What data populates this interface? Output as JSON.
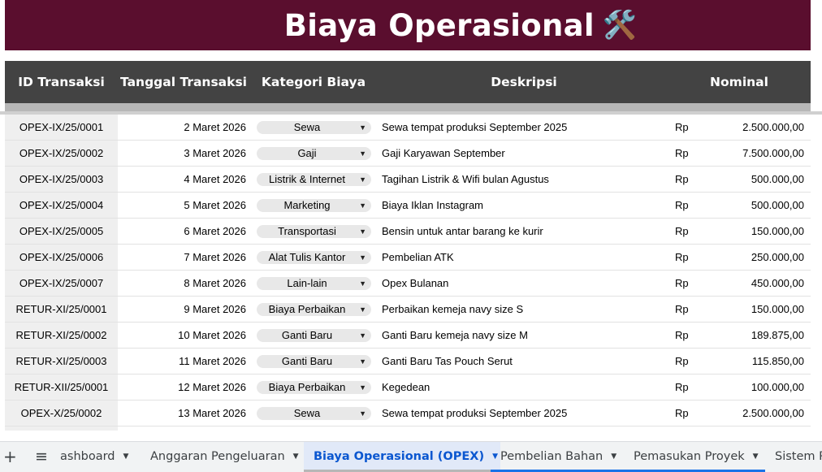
{
  "sheet": {
    "title": "Biaya Operasional",
    "title_icon": "🛠️",
    "headers": {
      "id": "ID Transaksi",
      "date": "Tanggal Transaksi",
      "category": "Kategori Biaya",
      "description": "Deskripsi",
      "amount": "Nominal"
    },
    "rows": [
      {
        "id": "OPEX-IX/25/0001",
        "date": "2 Maret 2026",
        "category": "Sewa",
        "description": "Sewa tempat produksi September 2025",
        "currency": "Rp",
        "amount": "2.500.000,00"
      },
      {
        "id": "OPEX-IX/25/0002",
        "date": "3 Maret 2026",
        "category": "Gaji",
        "description": "Gaji Karyawan September",
        "currency": "Rp",
        "amount": "7.500.000,00"
      },
      {
        "id": "OPEX-IX/25/0003",
        "date": "4 Maret 2026",
        "category": "Listrik & Internet",
        "description": "Tagihan Listrik & Wifi bulan Agustus",
        "currency": "Rp",
        "amount": "500.000,00"
      },
      {
        "id": "OPEX-IX/25/0004",
        "date": "5 Maret 2026",
        "category": "Marketing",
        "description": "Biaya Iklan Instagram",
        "currency": "Rp",
        "amount": "500.000,00"
      },
      {
        "id": "OPEX-IX/25/0005",
        "date": "6 Maret 2026",
        "category": "Transportasi",
        "description": "Bensin untuk antar barang ke kurir",
        "currency": "Rp",
        "amount": "150.000,00"
      },
      {
        "id": "OPEX-IX/25/0006",
        "date": "7 Maret 2026",
        "category": "Alat Tulis Kantor",
        "description": "Pembelian ATK",
        "currency": "Rp",
        "amount": "250.000,00"
      },
      {
        "id": "OPEX-IX/25/0007",
        "date": "8 Maret 2026",
        "category": "Lain-lain",
        "description": "Opex Bulanan",
        "currency": "Rp",
        "amount": "450.000,00"
      },
      {
        "id": "RETUR-XI/25/0001",
        "date": "9 Maret 2026",
        "category": "Biaya Perbaikan",
        "description": "Perbaikan kemeja navy size S",
        "currency": "Rp",
        "amount": "150.000,00"
      },
      {
        "id": "RETUR-XI/25/0002",
        "date": "10 Maret 2026",
        "category": "Ganti Baru",
        "description": "Ganti Baru kemeja navy size M",
        "currency": "Rp",
        "amount": "189.875,00"
      },
      {
        "id": "RETUR-XI/25/0003",
        "date": "11 Maret 2026",
        "category": "Ganti Baru",
        "description": "Ganti Baru Tas Pouch Serut",
        "currency": "Rp",
        "amount": "115.850,00"
      },
      {
        "id": "RETUR-XII/25/0001",
        "date": "12 Maret 2026",
        "category": "Biaya Perbaikan",
        "description": "Kegedean",
        "currency": "Rp",
        "amount": "100.000,00"
      },
      {
        "id": "OPEX-X/25/0002",
        "date": "13 Maret 2026",
        "category": "Sewa",
        "description": "Sewa tempat produksi September 2025",
        "currency": "Rp",
        "amount": "2.500.000,00"
      }
    ]
  },
  "tabbar": {
    "add_symbol": "+",
    "menu_symbol": "≡",
    "tabs": [
      {
        "label": "ashboard"
      },
      {
        "label": "Anggaran Pengeluaran"
      },
      {
        "label": "Biaya Operasional (OPEX)"
      },
      {
        "label": "Pembelian Bahan"
      },
      {
        "label": "Pemasukan Proyek"
      },
      {
        "label": "Sistem P"
      }
    ],
    "underline_colors": [
      "#b7b7b7",
      "#1a73e8",
      "#1a73e8"
    ]
  },
  "colors": {
    "title_bg": "#5a0e2e",
    "header_bg": "#434343",
    "active_tab_text": "#0b57d0"
  },
  "icons": {
    "title": "tools-icon",
    "add": "plus-icon",
    "menu": "all-sheets-menu-icon",
    "dropdown": "dropdown-caret-icon"
  }
}
